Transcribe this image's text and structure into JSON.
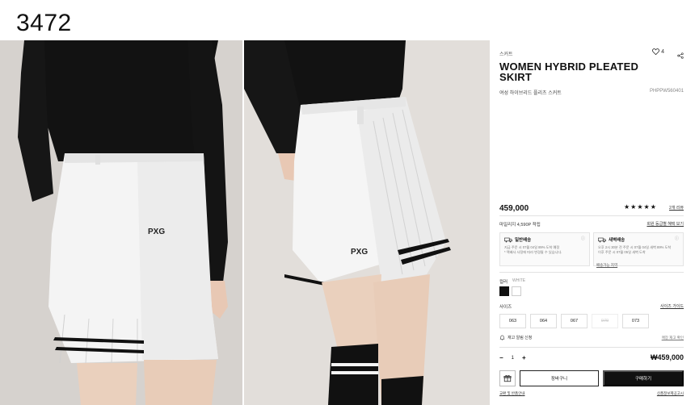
{
  "page": {
    "label": "3472"
  },
  "product": {
    "category": "스커트",
    "title_line1": "WOMEN HYBRID PLEATED",
    "title_line2": "SKIRT",
    "subtitle": "여성 하이브리드 플리츠 스커트",
    "code": "PHPPW560401",
    "wishlist_count": "4",
    "price": "459,000",
    "rating_stars": "★★★★★",
    "review_count": "2개 리뷰",
    "points_label": "예상 적립금",
    "points_text": "마일리지 4,590P 적립",
    "benefit_link": "회원 등급별 혜택 보기",
    "rating": 5
  },
  "shipping": {
    "normal": {
      "title": "일반배송",
      "line1": "지금 주문 시 07월 04일 89% 도착 예정",
      "line2": "* 택배사 사정에 따라 변경될 수 있습니다."
    },
    "dawn": {
      "title": "새벽배송",
      "line1": "오후 2시 30분 전 주문 시 07월 04일 새벽 89% 도착",
      "line2": "이후 주문 시 07월 05일 새벽 도착",
      "link": "배송가능 지역"
    }
  },
  "options": {
    "color_label": "컬러",
    "color_value": "WHITE",
    "size_label": "사이즈",
    "size_guide": "사이즈 가이드",
    "sizes": [
      "063",
      "064",
      "067",
      "070",
      "073"
    ],
    "restock_label": "재고 알림 신청",
    "restock_right": "매장 재고 확인"
  },
  "order": {
    "qty_minus": "−",
    "qty": "1",
    "qty_plus": "+",
    "total": "₩459,000",
    "cart_label": "장바구니",
    "buy_label": "구매하기",
    "foot_left": "교환 및 반품안내",
    "foot_right": "상품정보제공고시"
  }
}
